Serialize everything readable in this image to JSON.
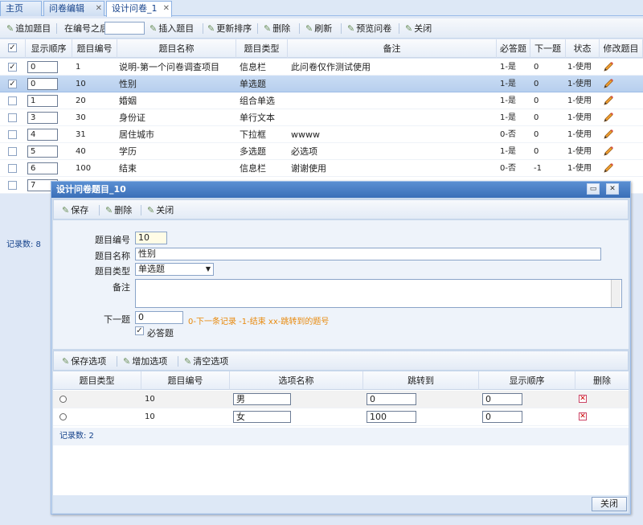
{
  "tabs": [
    {
      "label": "主页",
      "active": false
    },
    {
      "label": "问卷编辑",
      "active": false
    },
    {
      "label": "设计问卷_1",
      "active": true
    }
  ],
  "toolbar": {
    "add_question": "追加题目",
    "after_number_label": "在编号之后",
    "after_number_value": "",
    "insert_question": "插入题目",
    "update_sort": "更新排序",
    "delete": "删除",
    "refresh": "刷新",
    "preview": "预览问卷",
    "close": "关闭"
  },
  "grid": {
    "headers": [
      "显示顺序",
      "题目编号",
      "题目名称",
      "题目类型",
      "备注",
      "必答题",
      "下一题",
      "状态",
      "修改题目"
    ],
    "rows": [
      {
        "checked": true,
        "order": "0",
        "num": "1",
        "name": "说明-第一个问卷调查项目",
        "type": "信息栏",
        "note": "此问卷仅作测试使用",
        "required": "1-是",
        "next": "0",
        "status": "1-使用",
        "selected": false
      },
      {
        "checked": true,
        "order": "0",
        "num": "10",
        "name": "性别",
        "type": "单选题",
        "note": "",
        "required": "1-是",
        "next": "0",
        "status": "1-使用",
        "selected": true
      },
      {
        "checked": false,
        "order": "1",
        "num": "20",
        "name": "婚姻",
        "type": "组合单选",
        "note": "",
        "required": "1-是",
        "next": "0",
        "status": "1-使用",
        "selected": false
      },
      {
        "checked": false,
        "order": "3",
        "num": "30",
        "name": "身份证",
        "type": "单行文本",
        "note": "",
        "required": "1-是",
        "next": "0",
        "status": "1-使用",
        "selected": false
      },
      {
        "checked": false,
        "order": "4",
        "num": "31",
        "name": "居住城市",
        "type": "下拉框",
        "note": "wwww",
        "required": "0-否",
        "next": "0",
        "status": "1-使用",
        "selected": false
      },
      {
        "checked": false,
        "order": "5",
        "num": "40",
        "name": "学历",
        "type": "多选题",
        "note": "必选项",
        "required": "1-是",
        "next": "0",
        "status": "1-使用",
        "selected": false
      },
      {
        "checked": false,
        "order": "6",
        "num": "100",
        "name": "结束",
        "type": "信息栏",
        "note": "谢谢使用",
        "required": "0-否",
        "next": "-1",
        "status": "1-使用",
        "selected": false
      },
      {
        "checked": false,
        "order": "7",
        "num": "",
        "name": "",
        "type": "",
        "note": "",
        "required": "",
        "next": "",
        "status": "",
        "selected": false
      }
    ],
    "record_count": "记录数: 8"
  },
  "dialog": {
    "title": "设计问卷题目_10",
    "save": "保存",
    "delete": "删除",
    "close": "关闭",
    "fields": {
      "num_label": "题目编号",
      "num_value": "10",
      "name_label": "题目名称",
      "name_value": "性别",
      "type_label": "题目类型",
      "type_value": "单选题",
      "note_label": "备注",
      "note_value": "",
      "next_label": "下一题",
      "next_value": "0",
      "next_hint": "0-下一条记录 -1-结束 xx-跳转到的题号",
      "required_label": "必答题",
      "required_checked": true
    },
    "options_toolbar": {
      "save": "保存选项",
      "add": "增加选项",
      "clear": "清空选项"
    },
    "options": {
      "headers": [
        "题目类型",
        "题目编号",
        "选项名称",
        "跳转到",
        "显示顺序",
        "删除"
      ],
      "rows": [
        {
          "num": "10",
          "name": "男",
          "jump": "0",
          "order": "0"
        },
        {
          "num": "10",
          "name": "女",
          "jump": "100",
          "order": "0"
        }
      ],
      "record_count": "记录数: 2"
    },
    "close_button": "关闭"
  },
  "icons": {
    "accent": "#15428b",
    "edit_pencil": "pencil-icon"
  }
}
